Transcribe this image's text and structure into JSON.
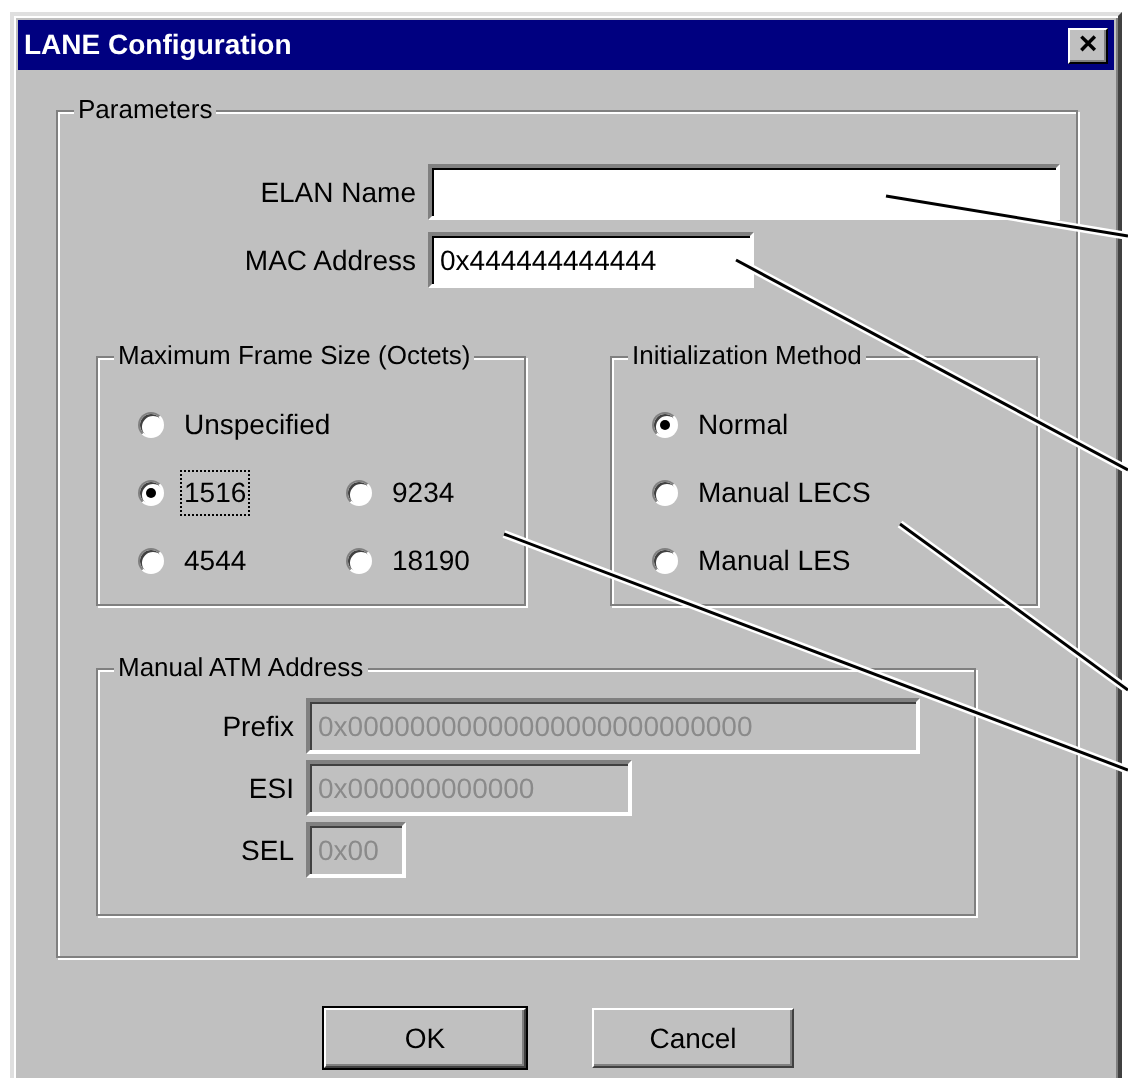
{
  "window": {
    "title": "LANE Configuration",
    "close": "×"
  },
  "parameters": {
    "title": "Parameters",
    "fields": [
      {
        "label": "ELAN Name",
        "disabled": false
      },
      {
        "label": "MAC Address",
        "value": "0x444444444444",
        "disabled": false
      }
    ],
    "frame_size": {
      "title": "Maximum Frame Size (Octets)",
      "options": [
        {
          "label": "Unspecified",
          "selected": false,
          "focused": false
        },
        {
          "label": "1516",
          "selected": true,
          "focused": true
        },
        {
          "label": "9234",
          "selected": false,
          "focused": false
        },
        {
          "label": "4544",
          "selected": false,
          "focused": false
        },
        {
          "label": "18190",
          "selected": false,
          "focused": false
        }
      ]
    },
    "init_method": {
      "title": "Initialization Method",
      "options": [
        {
          "label": "Normal",
          "selected": true,
          "focused": false
        },
        {
          "label": "Manual LECS",
          "selected": false,
          "focused": false
        },
        {
          "label": "Manual LES",
          "selected": false,
          "focused": false
        }
      ]
    },
    "manual_atm": {
      "title": "Manual ATM Address",
      "fields": [
        {
          "label": "Prefix",
          "value": "0x00000000000000000000000000",
          "disabled": true
        },
        {
          "label": "ESI",
          "value": "0x000000000000",
          "disabled": true
        },
        {
          "label": "SEL",
          "value": "0x00",
          "disabled": true
        }
      ]
    }
  },
  "buttons": [
    {
      "label": "OK",
      "default": true
    },
    {
      "label": "Cancel",
      "default": false
    }
  ]
}
